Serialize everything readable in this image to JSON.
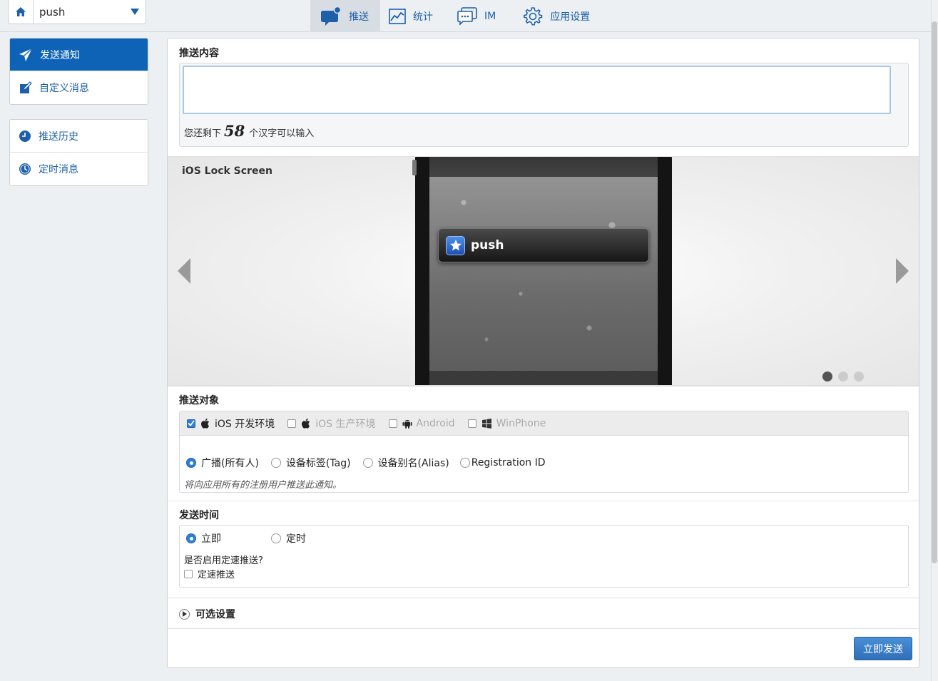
{
  "app_selector": {
    "name": "push"
  },
  "nav": {
    "tabs": [
      {
        "label": "推送",
        "icon": "chat-bubble-icon",
        "active": true
      },
      {
        "label": "统计",
        "icon": "chart-icon",
        "active": false
      },
      {
        "label": "IM",
        "icon": "message-icon",
        "active": false
      },
      {
        "label": "应用设置",
        "icon": "gear-icon",
        "active": false
      }
    ]
  },
  "sidebar": {
    "group1": [
      {
        "label": "发送通知",
        "icon": "paper-plane-icon",
        "active": true
      },
      {
        "label": "自定义消息",
        "icon": "edit-icon",
        "active": false
      }
    ],
    "group2": [
      {
        "label": "推送历史",
        "icon": "history-icon",
        "active": false
      },
      {
        "label": "定时消息",
        "icon": "clock-icon",
        "active": false
      }
    ]
  },
  "content": {
    "title": "推送内容",
    "textarea_value": "",
    "remain_prefix": "您还剩下",
    "remain_count": "58",
    "remain_suffix": "个汉字可以输入"
  },
  "preview": {
    "title": "iOS Lock Screen",
    "notification_text": "push",
    "slides": 3,
    "active_slide": 1
  },
  "target": {
    "title": "推送对象",
    "platforms": [
      {
        "label": "iOS 开发环境",
        "checked": true,
        "enabled": true,
        "icon": "apple-icon"
      },
      {
        "label": "iOS 生产环境",
        "checked": false,
        "enabled": false,
        "icon": "apple-icon"
      },
      {
        "label": "Android",
        "checked": false,
        "enabled": false,
        "icon": "android-icon"
      },
      {
        "label": "WinPhone",
        "checked": false,
        "enabled": false,
        "icon": "windows-icon"
      }
    ],
    "audience": [
      {
        "label": "广播(所有人)",
        "checked": true
      },
      {
        "label": "设备标签(Tag)",
        "checked": false
      },
      {
        "label": "设备别名(Alias)",
        "checked": false
      },
      {
        "label": "Registration ID",
        "checked": false
      }
    ],
    "hint": "将向应用所有的注册用户推送此通知。"
  },
  "time": {
    "title": "发送时间",
    "options": [
      {
        "label": "立即",
        "checked": true
      },
      {
        "label": "定时",
        "checked": false
      }
    ],
    "speed_question": "是否启用定速推送?",
    "speed_label": "定速推送",
    "speed_checked": false
  },
  "optional": {
    "label": "可选设置"
  },
  "send_button": {
    "label": "立即发送"
  },
  "colors": {
    "accent": "#0e63b6",
    "link": "#1d5fa8",
    "button": "#3a7fc8"
  }
}
